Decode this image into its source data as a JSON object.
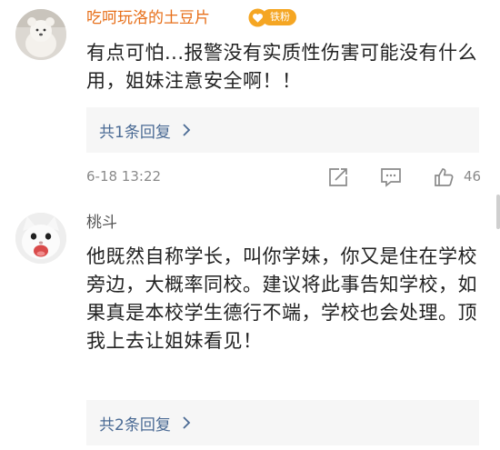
{
  "comments": [
    {
      "username": "吃呵玩洛的土豆片",
      "badge_label": "铁粉",
      "text": "有点可怕...报警没有实质性伤害可能没有什么用，姐妹注意安全啊！！",
      "replies_label": "共1条回复",
      "timestamp": "6-18 13:22",
      "like_count": "46"
    },
    {
      "username": "桃斗",
      "text": "他既然自称学长，叫你学妹，你又是住在学校旁边，大概率同校。建议将此事告知学校，如果真是本校学生德行不端，学校也会处理。顶我上去让姐妹看见！",
      "replies_label": "共2条回复"
    }
  ],
  "icons": {
    "repost": "repost-icon",
    "comment": "comment-icon",
    "like": "thumbs-up-icon",
    "fan_badge": "heart-icon",
    "chevron": "chevron-right-icon"
  },
  "colors": {
    "vip_username": "#e76f19",
    "reply_link": "#4a6a94",
    "badge": "#f5a623"
  }
}
